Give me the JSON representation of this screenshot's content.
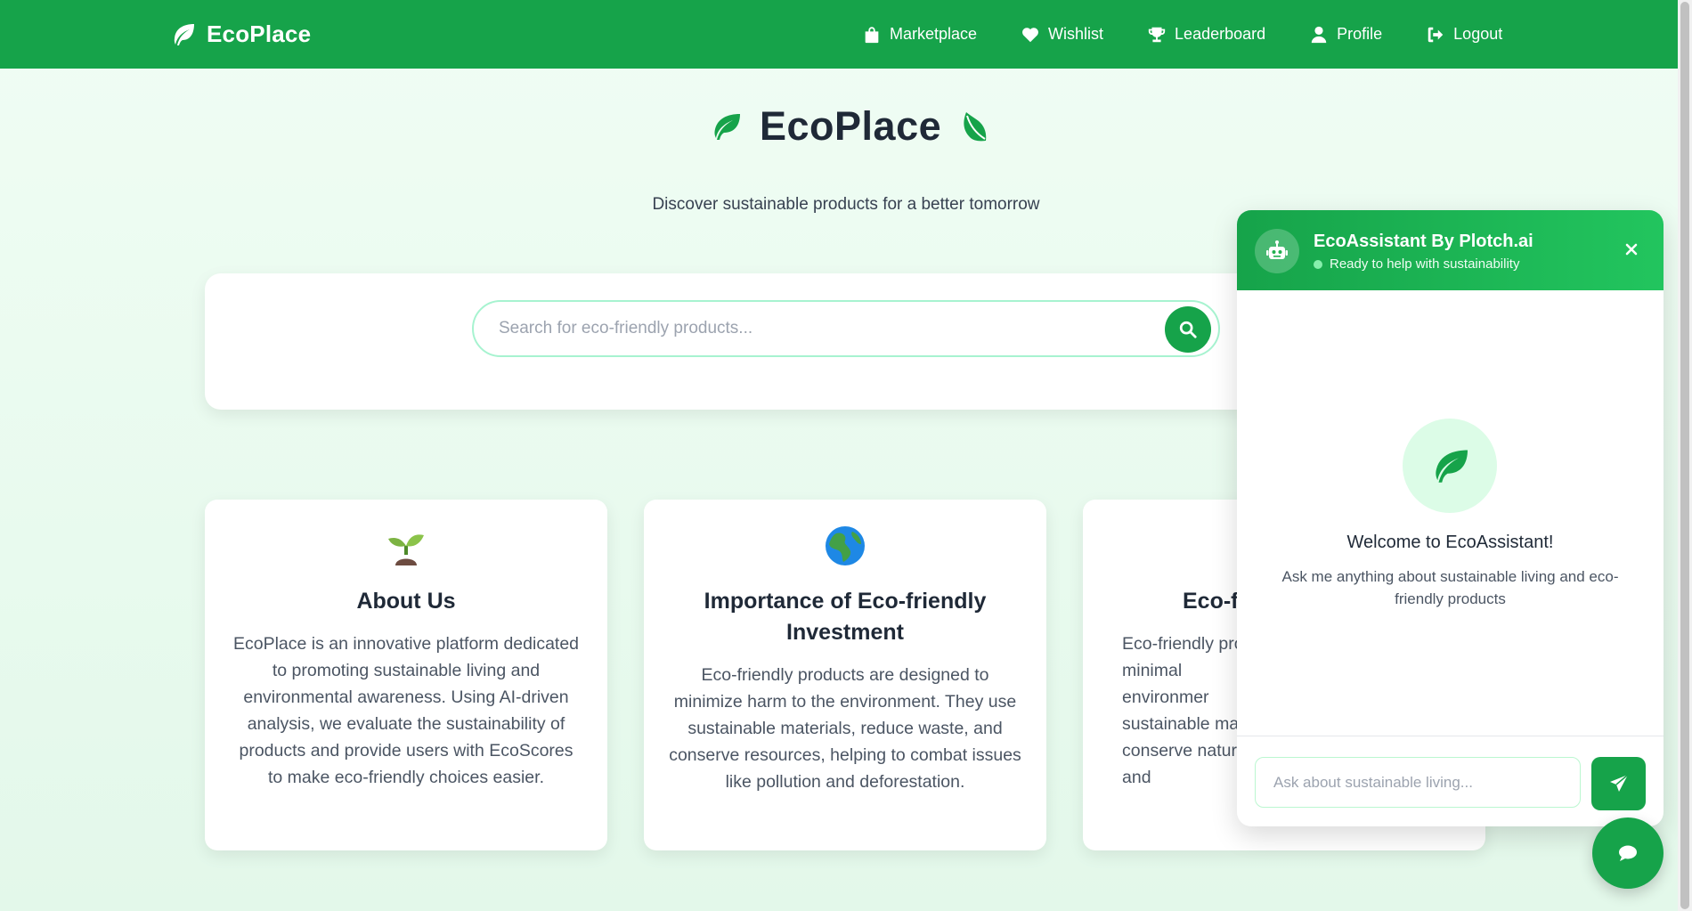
{
  "navbar": {
    "brand": "EcoPlace",
    "brand_icon": "leaf-icon",
    "links": [
      {
        "label": "Marketplace",
        "icon": "shopping-bag-icon"
      },
      {
        "label": "Wishlist",
        "icon": "heart-icon"
      },
      {
        "label": "Leaderboard",
        "icon": "trophy-icon"
      },
      {
        "label": "Profile",
        "icon": "user-icon"
      },
      {
        "label": "Logout",
        "icon": "logout-icon"
      }
    ]
  },
  "hero": {
    "title": "EcoPlace",
    "subtitle": "Discover sustainable products for a better tomorrow"
  },
  "search": {
    "placeholder": "Search for eco-friendly products...",
    "value": ""
  },
  "cards": [
    {
      "icon": "seedling-icon",
      "title": "About Us",
      "text": "EcoPlace is an innovative platform dedicated to promoting sustainable living and environmental awareness. Using AI-driven analysis, we evaluate the sustainability of products and provide users with EcoScores to make eco-friendly choices easier."
    },
    {
      "icon": "globe-icon",
      "title": "Importance of Eco-friendly Investment",
      "text": "Eco-friendly products are designed to minimize harm to the environment. They use sustainable materials, reduce waste, and conserve resources, helping to combat issues like pollution and deforestation."
    },
    {
      "icon": "",
      "title": "Eco-fri",
      "text": "Eco-friendly pro a minimal environmer sustainable ma conserve natura and"
    }
  ],
  "chat": {
    "title": "EcoAssistant By Plotch.ai",
    "status": "Ready to help with sustainability",
    "welcome_title": "Welcome to EcoAssistant!",
    "welcome_text": "Ask me anything about sustainable living and eco-friendly products",
    "input_placeholder": "Ask about sustainable living...",
    "input_value": ""
  },
  "colors": {
    "primary": "#16a34a",
    "primary_light": "#22c55e",
    "background": "#f0fdf4",
    "text_dark": "#1f2937"
  }
}
